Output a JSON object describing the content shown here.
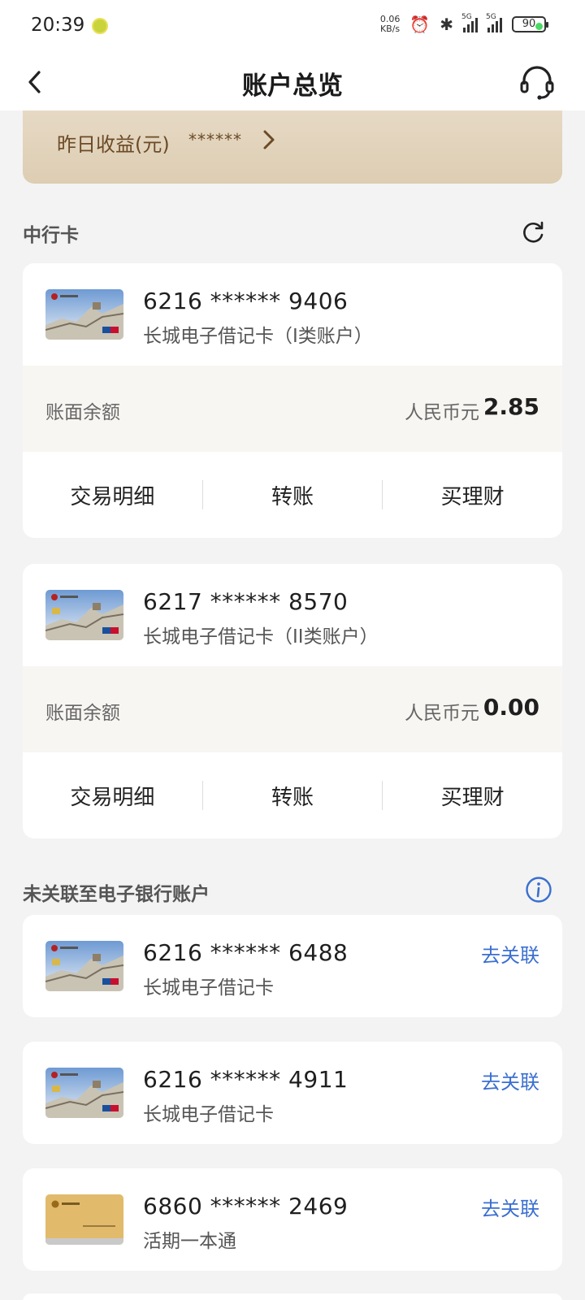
{
  "status_bar": {
    "time": "20:39",
    "speed_value": "0.06",
    "speed_unit": "KB/s",
    "signal1": "5G",
    "signal2": "5G",
    "battery": "90"
  },
  "nav": {
    "title": "账户总览"
  },
  "earnings": {
    "label": "昨日收益(元)",
    "masked_value": "******"
  },
  "sections": {
    "boc_cards": "中行卡",
    "unlinked": "未关联至电子银行账户"
  },
  "linked_cards": [
    {
      "number": "6216 ****** 9406",
      "type": "长城电子借记卡（I类账户）",
      "balance_label": "账面余额",
      "currency": "人民币元",
      "balance": "2.85",
      "actions": [
        "交易明细",
        "转账",
        "买理财"
      ]
    },
    {
      "number": "6217 ****** 8570",
      "type": "长城电子借记卡（II类账户）",
      "balance_label": "账面余额",
      "currency": "人民币元",
      "balance": "0.00",
      "actions": [
        "交易明细",
        "转账",
        "买理财"
      ]
    }
  ],
  "unlinked_cards": [
    {
      "number": "6216 ****** 6488",
      "type": "长城电子借记卡",
      "action": "去关联"
    },
    {
      "number": "6216 ****** 4911",
      "type": "长城电子借记卡",
      "action": "去关联"
    },
    {
      "number": "6860 ****** 2469",
      "type": "活期一本通",
      "action": "去关联"
    }
  ],
  "colors": {
    "link": "#3a6fd0",
    "banner": "#e3d5bf",
    "banner_text": "#6b4a26"
  },
  "icons": [
    "back-icon",
    "customer-service-icon",
    "chevron-right-icon",
    "refresh-icon",
    "info-icon",
    "card-thumbnail"
  ]
}
